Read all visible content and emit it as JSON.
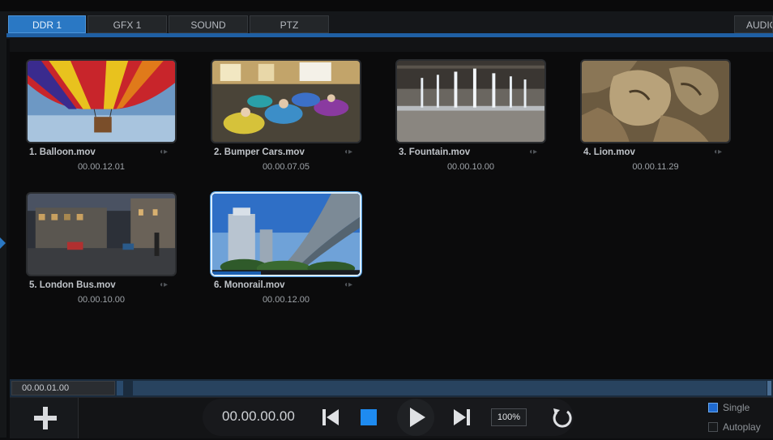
{
  "tabs": [
    {
      "label": "DDR 1",
      "active": true
    },
    {
      "label": "GFX 1",
      "active": false
    },
    {
      "label": "SOUND",
      "active": false
    },
    {
      "label": "PTZ",
      "active": false
    },
    {
      "label": "AUDIO",
      "active": false
    }
  ],
  "clips": [
    {
      "name": "1. Balloon.mov",
      "duration": "00.00.12.01",
      "selected": false,
      "audio_icon": "audio-icon"
    },
    {
      "name": "2. Bumper Cars.mov",
      "duration": "00.00.07.05",
      "selected": false,
      "audio_icon": "audio-icon"
    },
    {
      "name": "3. Fountain.mov",
      "duration": "00.00.10.00",
      "selected": false,
      "audio_icon": "audio-icon"
    },
    {
      "name": "4. Lion.mov",
      "duration": "00.00.11.29",
      "selected": false,
      "audio_icon": "audio-icon"
    },
    {
      "name": "5. London Bus.mov",
      "duration": "00.00.10.00",
      "selected": false,
      "audio_icon": "audio-icon"
    },
    {
      "name": "6. Monorail.mov",
      "duration": "00.00.12.00",
      "selected": true,
      "audio_icon": "audio-icon",
      "progress": 0.33
    }
  ],
  "scrubber": {
    "time": "00.00.01.00"
  },
  "transport": {
    "timecode": "00.00.00.00",
    "zoom": "100%",
    "buttons": [
      "skip-back-icon",
      "stop-icon",
      "play-icon",
      "skip-forward-icon",
      "loop-icon"
    ]
  },
  "options": {
    "single": {
      "label": "Single",
      "checked": true
    },
    "autoplay": {
      "label": "Autoplay",
      "checked": false
    }
  },
  "colors": {
    "accent": "#2a78c4",
    "stop": "#1e8bf0",
    "background": "#0b0b0c"
  }
}
